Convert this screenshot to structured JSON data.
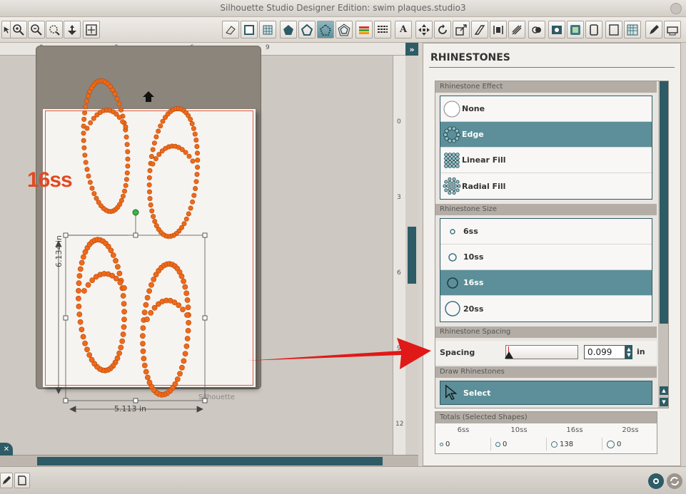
{
  "window": {
    "title": "Silhouette Studio Designer Edition: swim plaques.studio3"
  },
  "toolbar": {
    "left_tools": [
      "select-icon",
      "zoom-in-icon",
      "zoom-out-icon",
      "zoom-select-icon",
      "pan-icon",
      "fit-page-icon"
    ],
    "right_tools": [
      "eraser-icon",
      "page-setup-icon",
      "grid-icon",
      "fill-icon",
      "line-style-icon",
      "outline-icon",
      "rhinestone-icon",
      "offset-icon",
      "color-icon",
      "stroke-icon",
      "text-icon",
      "move-icon",
      "rotate-icon",
      "scale-icon",
      "shear-icon",
      "align-icon",
      "replicate-icon",
      "modify-icon",
      "trace-icon",
      "cut-settings-icon",
      "send-icon",
      "library-icon",
      "store-icon"
    ]
  },
  "canvas": {
    "ruler_top": [
      "0",
      "3",
      "6",
      "9"
    ],
    "ruler_side": [
      "0",
      "3",
      "6",
      "9",
      "12"
    ],
    "size_label": "16ss",
    "height_dimension": "6.134 in",
    "width_dimension": "5.113 in",
    "mat_brand": "Silhouette"
  },
  "panel": {
    "title": "RHINESTONES",
    "effect": {
      "header": "Rhinestone Effect",
      "options": [
        {
          "label": "None",
          "icon": "none-icon",
          "selected": false
        },
        {
          "label": "Edge",
          "icon": "edge-icon",
          "selected": true
        },
        {
          "label": "Linear Fill",
          "icon": "linear-fill-icon",
          "selected": false
        },
        {
          "label": "Radial Fill",
          "icon": "radial-fill-icon",
          "selected": false
        }
      ]
    },
    "size": {
      "header": "Rhinestone Size",
      "options": [
        {
          "label": "6ss",
          "selected": false
        },
        {
          "label": "10ss",
          "selected": false
        },
        {
          "label": "16ss",
          "selected": true
        },
        {
          "label": "20ss",
          "selected": false
        }
      ]
    },
    "spacing": {
      "header": "Rhinestone Spacing",
      "label": "Spacing",
      "value": "0.099",
      "unit": "in"
    },
    "draw": {
      "header": "Draw Rhinestones",
      "button": "Select"
    },
    "totals": {
      "header": "Totals (Selected Shapes)",
      "columns": [
        "6ss",
        "10ss",
        "16ss",
        "20ss"
      ],
      "values": [
        "0",
        "0",
        "138",
        "0"
      ]
    }
  },
  "colors": {
    "accent": "#2d5b66",
    "selection": "#5c8f99",
    "rhinestone": "#ee6a1a",
    "arrow": "#e01818"
  }
}
